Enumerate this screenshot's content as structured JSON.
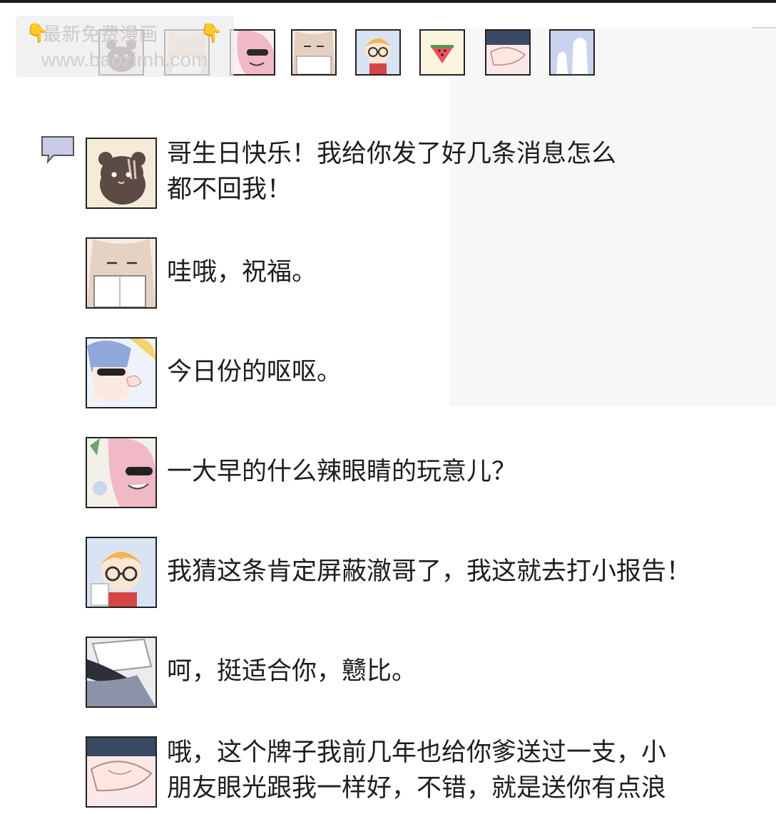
{
  "watermark": {
    "line1": "最新免费漫画",
    "line2": "www.baozimh.com"
  },
  "thumbnails": [
    {
      "icon": "squirrel-thumb-icon"
    },
    {
      "icon": "reading-girl-thumb-icon"
    },
    {
      "icon": "sunglasses-pink-thumb-icon"
    },
    {
      "icon": "book-girl-thumb-icon"
    },
    {
      "icon": "glasses-boy-thumb-icon"
    },
    {
      "icon": "watermelon-thumb-icon"
    },
    {
      "icon": "holding-hands-thumb-icon"
    },
    {
      "icon": "two-figures-thumb-icon"
    }
  ],
  "messages": [
    {
      "avatar": "squirrel-avatar",
      "text_lines": [
        "哥生日快乐！我给你发了好几条消息怎么",
        "都不回我！"
      ]
    },
    {
      "avatar": "reading-girl-avatar",
      "text_lines": [
        "哇哦，祝福。"
      ]
    },
    {
      "avatar": "blue-hair-sunglasses-avatar",
      "text_lines": [
        "今日份的呕呕。"
      ]
    },
    {
      "avatar": "pink-hair-sunglasses-avatar",
      "text_lines": [
        "一大早的什么辣眼睛的玩意儿？"
      ]
    },
    {
      "avatar": "glasses-boy-avatar",
      "text_lines": [
        "我猜这条肯定屏蔽澈哥了，我这就去打小报告！"
      ]
    },
    {
      "avatar": "sleeping-book-avatar",
      "text_lines": [
        "呵，挺适合你，戆比。"
      ]
    },
    {
      "avatar": "holding-hands-avatar",
      "text_lines": [
        "哦，这个牌子我前几年也给你爹送过一支，小",
        "朋友眼光跟我一样好，不错，就是送你有点浪"
      ]
    }
  ]
}
